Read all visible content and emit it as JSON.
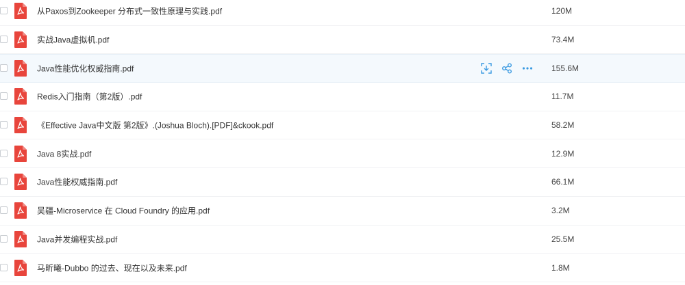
{
  "files": [
    {
      "name": "从Paxos到Zookeeper 分布式一致性原理与实践.pdf",
      "size": "120M",
      "icon": "pdf-file-icon"
    },
    {
      "name": "实战Java虚拟机.pdf",
      "size": "73.4M",
      "icon": "pdf-file-icon"
    },
    {
      "name": "Java性能优化权威指南.pdf",
      "size": "155.6M",
      "icon": "pdf-file-icon",
      "hovered": true
    },
    {
      "name": "Redis入门指南（第2版）.pdf",
      "size": "11.7M",
      "icon": "pdf-file-icon"
    },
    {
      "name": "《Effective Java中文版 第2版》.(Joshua Bloch).[PDF]&ckook.pdf",
      "size": "58.2M",
      "icon": "pdf-file-icon"
    },
    {
      "name": "Java 8实战.pdf",
      "size": "12.9M",
      "icon": "pdf-file-icon"
    },
    {
      "name": "Java性能权威指南.pdf",
      "size": "66.1M",
      "icon": "pdf-file-icon"
    },
    {
      "name": "吴疆-Microservice 在 Cloud Foundry 的应用.pdf",
      "size": "3.2M",
      "icon": "pdf-file-icon"
    },
    {
      "name": "Java并发编程实战.pdf",
      "size": "25.5M",
      "icon": "pdf-file-icon"
    },
    {
      "name": "马昕曦-Dubbo 的过去、现在以及未来.pdf",
      "size": "1.8M",
      "icon": "pdf-file-icon"
    }
  ],
  "row_actions": [
    {
      "icon": "download-icon"
    },
    {
      "icon": "share-icon"
    },
    {
      "icon": "more-icon"
    }
  ],
  "colors": {
    "pdf_red": "#e8453c",
    "accent": "#3b9ae1",
    "hover_bg": "#f4f9fd"
  }
}
